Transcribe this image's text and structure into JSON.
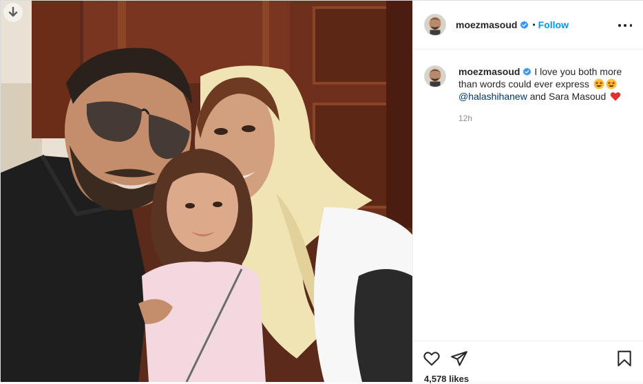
{
  "photo": {
    "download_icon": "arrow-down-icon"
  },
  "header": {
    "username": "moezmasoud",
    "separator": "•",
    "follow_label": "Follow",
    "verified_icon": "verified-badge-icon",
    "more_icon": "more-options-icon"
  },
  "caption": {
    "username": "moezmasoud",
    "text_before": " I love you both more than words could ever express ",
    "emojis": [
      "star-struck-emoji",
      "star-struck-emoji"
    ],
    "mention": "@halashihanew",
    "text_after": " and Sara Masoud ",
    "heart_emoji": "red-heart-emoji",
    "time": "12h"
  },
  "actions": {
    "like_icon": "heart-icon",
    "share_icon": "paper-plane-icon",
    "save_icon": "bookmark-icon",
    "likes": "4,578 likes"
  },
  "colors": {
    "accent": "#0095f6",
    "mention": "#00376b",
    "muted": "#8e8e8e",
    "text": "#262626",
    "verified": "#3897f0"
  }
}
